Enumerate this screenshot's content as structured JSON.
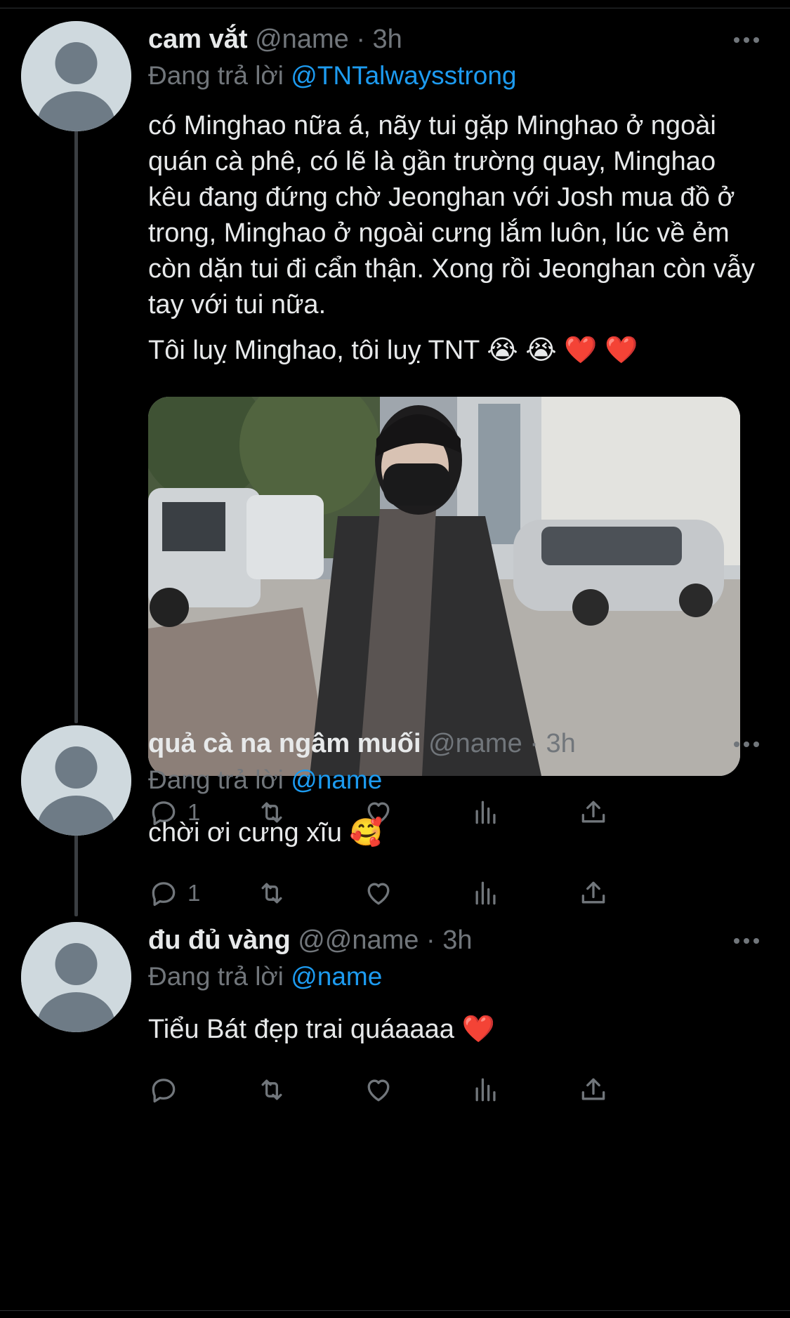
{
  "colors": {
    "background": "#000000",
    "text": "#e7e9ea",
    "secondary": "#71767b",
    "link": "#1d9bf0",
    "avatar_bg": "#cfd9de",
    "avatar_fg": "#6e7b86"
  },
  "tweets": [
    {
      "display_name": "cam vắt",
      "handle": "@name",
      "separator": "·",
      "time": "3h",
      "reply_prefix": "Đang trả lời",
      "reply_to": "@TNTalwaysstrong",
      "text": "có Minghao nữa á, nãy tui gặp Minghao ở ngoài quán cà phê, có lẽ là gần trường quay, Minghao kêu đang đứng chờ Jeonghan với Josh mua đồ ở trong, Minghao ở ngoài cưng lắm luôn, lúc về ẻm còn dặn tui đi cẩn thận. Xong rồi Jeonghan còn vẫy tay với tui nữa.",
      "text2": "Tôi luỵ Minghao, tôi luỵ TNT 😭 😭 ❤️ ❤️",
      "has_media": true,
      "reply_count": "1"
    },
    {
      "display_name": "quả cà na ngâm muối",
      "handle": "@name",
      "separator": "·",
      "time": "3h",
      "reply_prefix": "Đang trả lời",
      "reply_to": "@name",
      "text": "chời ơi cưng xĩu 🥰",
      "reply_count": "1"
    },
    {
      "display_name": "đu đủ vàng",
      "handle": "@@name",
      "separator": "·",
      "time": "3h",
      "reply_prefix": "Đang trả lời",
      "reply_to": "@name",
      "text": "Tiểu Bát đẹp trai quáaaaa ❤️",
      "reply_count": ""
    }
  ],
  "icons": {
    "reply": "reply-icon",
    "retweet": "retweet-icon",
    "like": "like-icon",
    "views": "views-icon",
    "share": "share-icon",
    "more": "more-icon"
  }
}
